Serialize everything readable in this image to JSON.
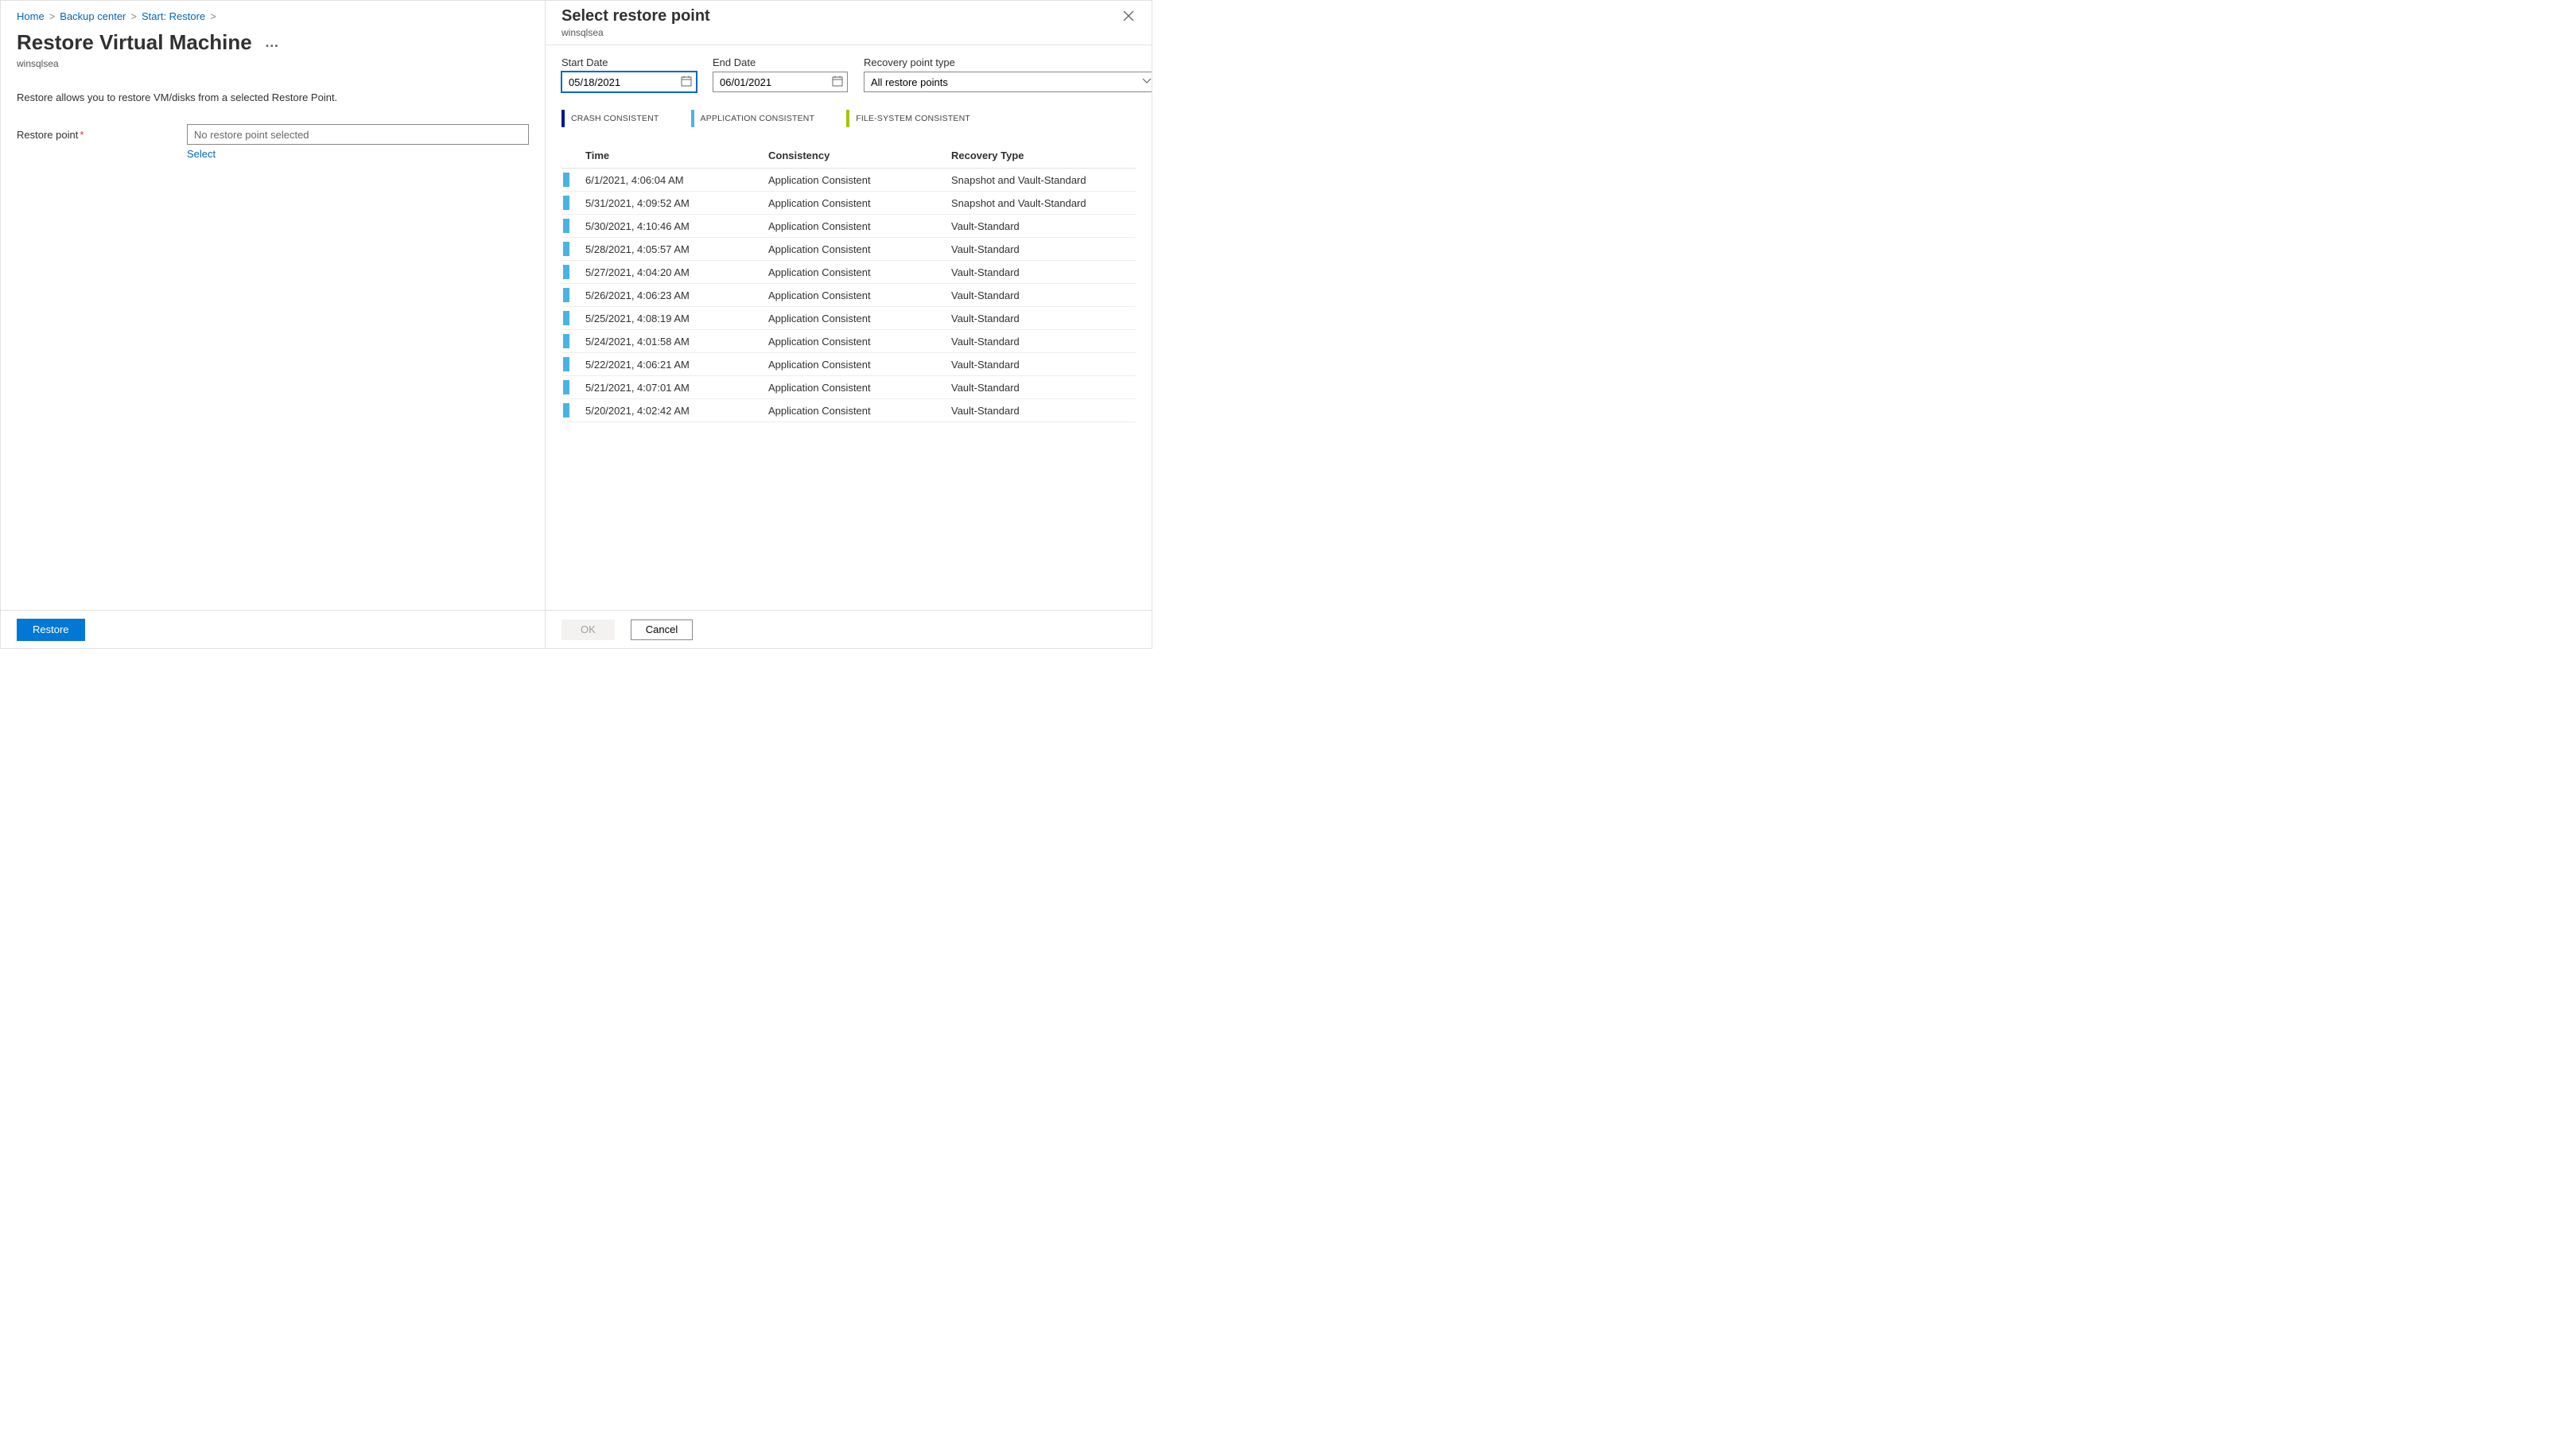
{
  "breadcrumb": [
    {
      "label": "Home"
    },
    {
      "label": "Backup center"
    },
    {
      "label": "Start: Restore"
    }
  ],
  "page": {
    "title": "Restore Virtual Machine",
    "subtitle": "winsqlsea",
    "description": "Restore allows you to restore VM/disks from a selected Restore Point."
  },
  "field": {
    "restore_point_label": "Restore point",
    "restore_point_value": "No restore point selected",
    "select_link": "Select"
  },
  "footer": {
    "restore_btn": "Restore"
  },
  "panel": {
    "title": "Select restore point",
    "subtitle": "winsqlsea",
    "start_date_label": "Start Date",
    "start_date_value": "05/18/2021",
    "end_date_label": "End Date",
    "end_date_value": "06/01/2021",
    "recovery_type_label": "Recovery point type",
    "recovery_type_value": "All restore points",
    "legend": {
      "crash": "CRASH CONSISTENT",
      "app": "APPLICATION CONSISTENT",
      "fs": "FILE-SYSTEM CONSISTENT"
    },
    "columns": {
      "time": "Time",
      "consistency": "Consistency",
      "recovery": "Recovery Type"
    },
    "rows": [
      {
        "time": "6/1/2021, 4:06:04 AM",
        "consistency": "Application Consistent",
        "recovery": "Snapshot and Vault-Standard"
      },
      {
        "time": "5/31/2021, 4:09:52 AM",
        "consistency": "Application Consistent",
        "recovery": "Snapshot and Vault-Standard"
      },
      {
        "time": "5/30/2021, 4:10:46 AM",
        "consistency": "Application Consistent",
        "recovery": "Vault-Standard"
      },
      {
        "time": "5/28/2021, 4:05:57 AM",
        "consistency": "Application Consistent",
        "recovery": "Vault-Standard"
      },
      {
        "time": "5/27/2021, 4:04:20 AM",
        "consistency": "Application Consistent",
        "recovery": "Vault-Standard"
      },
      {
        "time": "5/26/2021, 4:06:23 AM",
        "consistency": "Application Consistent",
        "recovery": "Vault-Standard"
      },
      {
        "time": "5/25/2021, 4:08:19 AM",
        "consistency": "Application Consistent",
        "recovery": "Vault-Standard"
      },
      {
        "time": "5/24/2021, 4:01:58 AM",
        "consistency": "Application Consistent",
        "recovery": "Vault-Standard"
      },
      {
        "time": "5/22/2021, 4:06:21 AM",
        "consistency": "Application Consistent",
        "recovery": "Vault-Standard"
      },
      {
        "time": "5/21/2021, 4:07:01 AM",
        "consistency": "Application Consistent",
        "recovery": "Vault-Standard"
      },
      {
        "time": "5/20/2021, 4:02:42 AM",
        "consistency": "Application Consistent",
        "recovery": "Vault-Standard"
      }
    ],
    "ok_btn": "OK",
    "cancel_btn": "Cancel"
  }
}
